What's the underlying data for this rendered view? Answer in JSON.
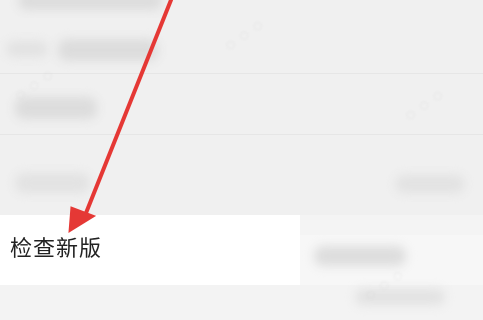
{
  "settings_row": {
    "label": "检查新版"
  },
  "colors": {
    "arrow": "#e53935",
    "label": "#222222",
    "row_background": "#ffffff",
    "page_background": "#f4f4f4"
  },
  "icons": [
    "arrow-pointer-icon"
  ]
}
